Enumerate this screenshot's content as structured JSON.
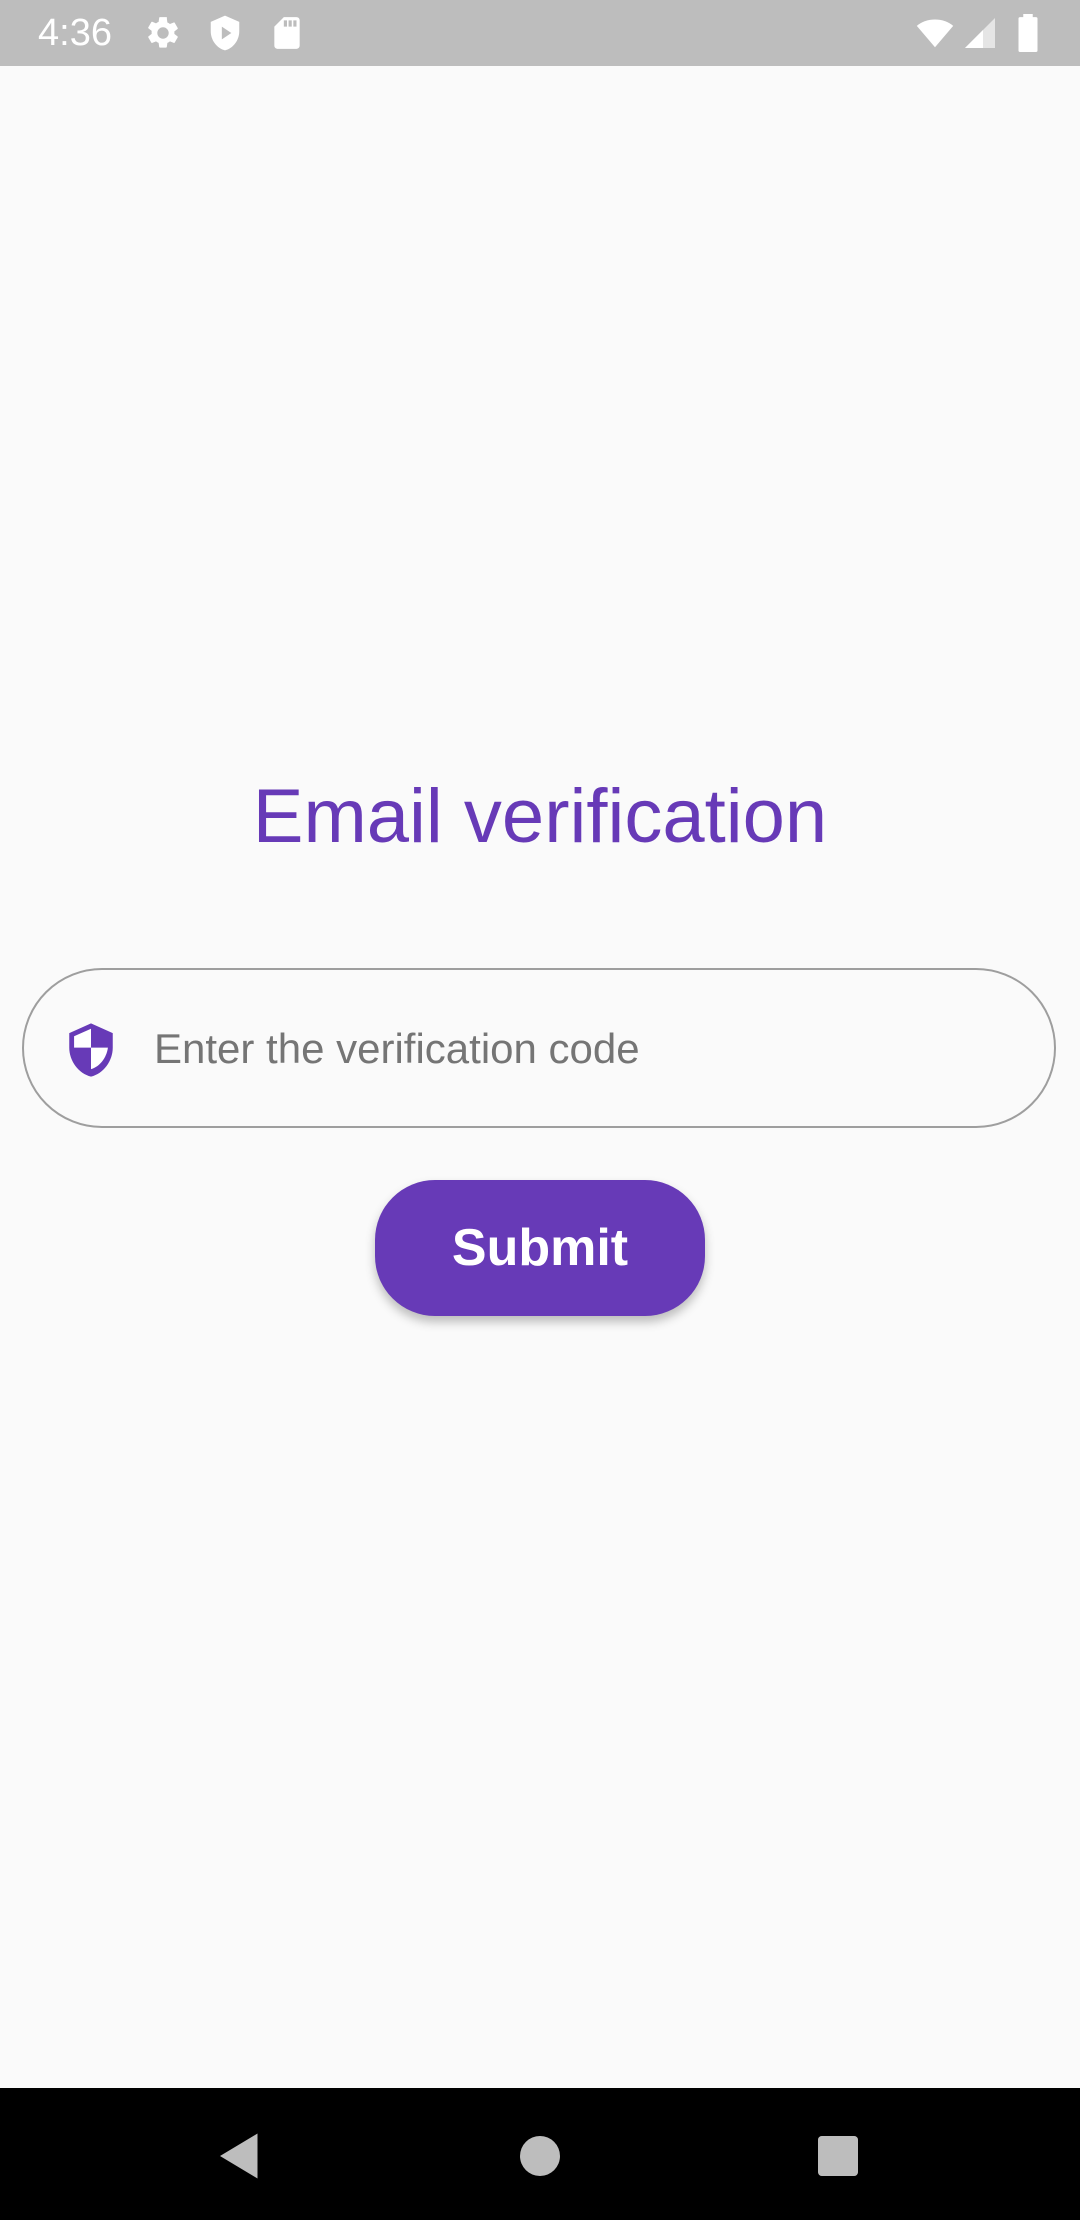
{
  "status_bar": {
    "time": "4:36",
    "icons": [
      "settings-icon",
      "play-protect-icon",
      "sd-card-icon",
      "wifi-icon",
      "cell-signal-icon",
      "battery-icon"
    ]
  },
  "page": {
    "title": "Email verification"
  },
  "verification_input": {
    "placeholder": "Enter the verification code",
    "value": "",
    "icon": "shield-icon"
  },
  "submit": {
    "label": "Submit"
  },
  "nav_bar": {
    "icons": [
      "back-icon",
      "home-icon",
      "recents-icon"
    ]
  },
  "colors": {
    "accent": "#673ab7",
    "background": "#fafafa",
    "status_bar": "#bdbdbd",
    "nav_bar": "#000000"
  }
}
